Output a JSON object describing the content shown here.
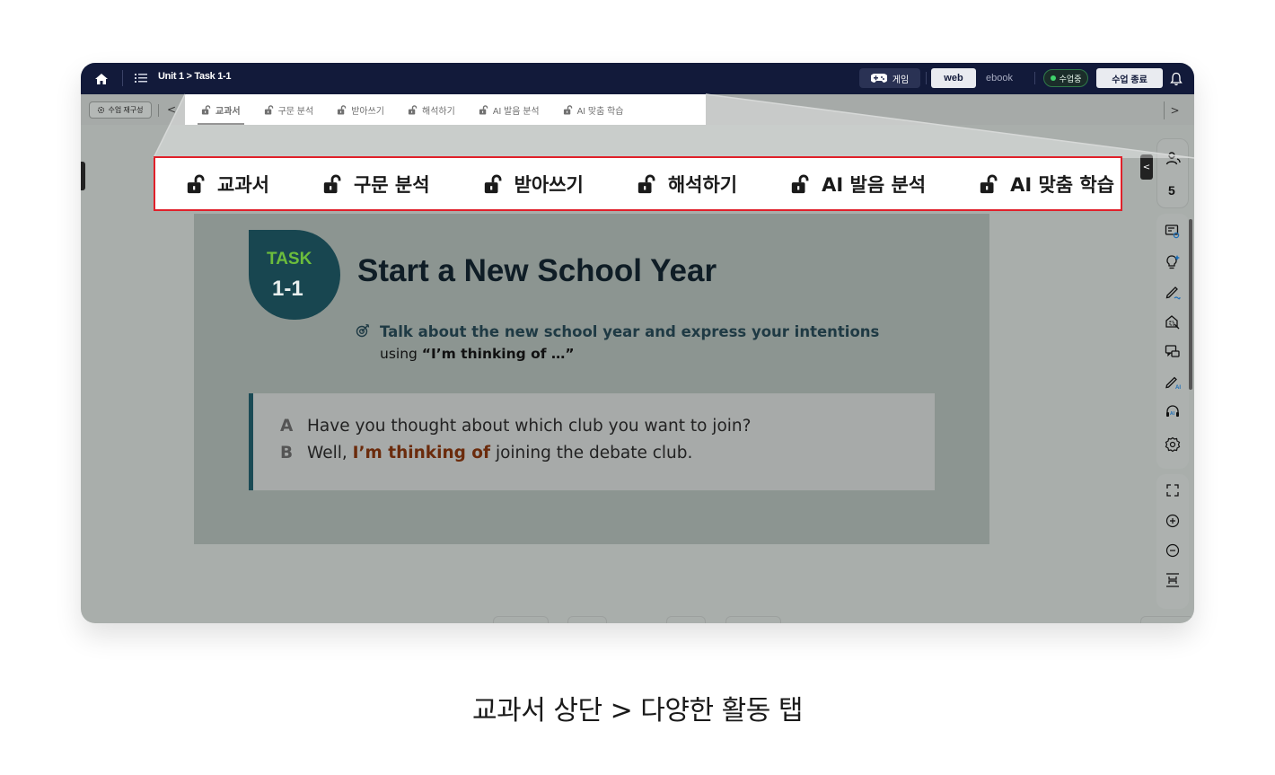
{
  "topbar": {
    "breadcrumb": "Unit 1 > Task 1-1",
    "game_label": "게임",
    "mode_web": "web",
    "mode_ebook": "ebook",
    "status_label": "수업중",
    "end_class_label": "수업 종료"
  },
  "subbar": {
    "restructure_label": "수업 재구성",
    "prev_arrow": "<",
    "next_arrow": ">",
    "tabs": [
      {
        "label": "교과서",
        "active": true
      },
      {
        "label": "구문 분석",
        "active": false
      },
      {
        "label": "받아쓰기",
        "active": false
      },
      {
        "label": "해석하기",
        "active": false
      },
      {
        "label": "AI 발음 분석",
        "active": false
      },
      {
        "label": "AI 맞춤 학습",
        "active": false
      }
    ]
  },
  "lesson": {
    "badge_top": "TASK",
    "badge_number": "1-1",
    "title": "Start a New School Year",
    "goal_bold": "Talk about the new school year and express your intentions",
    "goal_prefix": "using ",
    "goal_phrase": "“I’m thinking of …”",
    "dialog": [
      {
        "speaker": "A",
        "before": "Have you thought about which club you want to join?",
        "highlight": "",
        "after": ""
      },
      {
        "speaker": "B",
        "before": "Well, ",
        "highlight": "I’m thinking of",
        "after": " joining the debate club."
      }
    ]
  },
  "sidebar": {
    "collapse_arrow": "<",
    "users_count": "5",
    "tools": [
      "board-icon",
      "hint-icon",
      "pen-icon",
      "capture-icon",
      "chat-icon",
      "ai-pen-icon",
      "ai-audio-icon",
      "settings-icon",
      "fullscreen-icon",
      "zoom-in-icon",
      "zoom-out-icon",
      "fit-height-icon"
    ]
  },
  "zoom_tabs": [
    "교과서",
    "구문 분석",
    "받아쓰기",
    "해석하기",
    "AI 발음 분석",
    "AI 맞춤 학습"
  ],
  "caption": "교과서 상단 > 다양한 활동 탭",
  "colors": {
    "topbar": "#121a3a",
    "highlight_border": "#e0202a",
    "badge": "#184650",
    "badge_accent": "#6cbd3c",
    "phrase_highlight": "#6b2b0c"
  }
}
